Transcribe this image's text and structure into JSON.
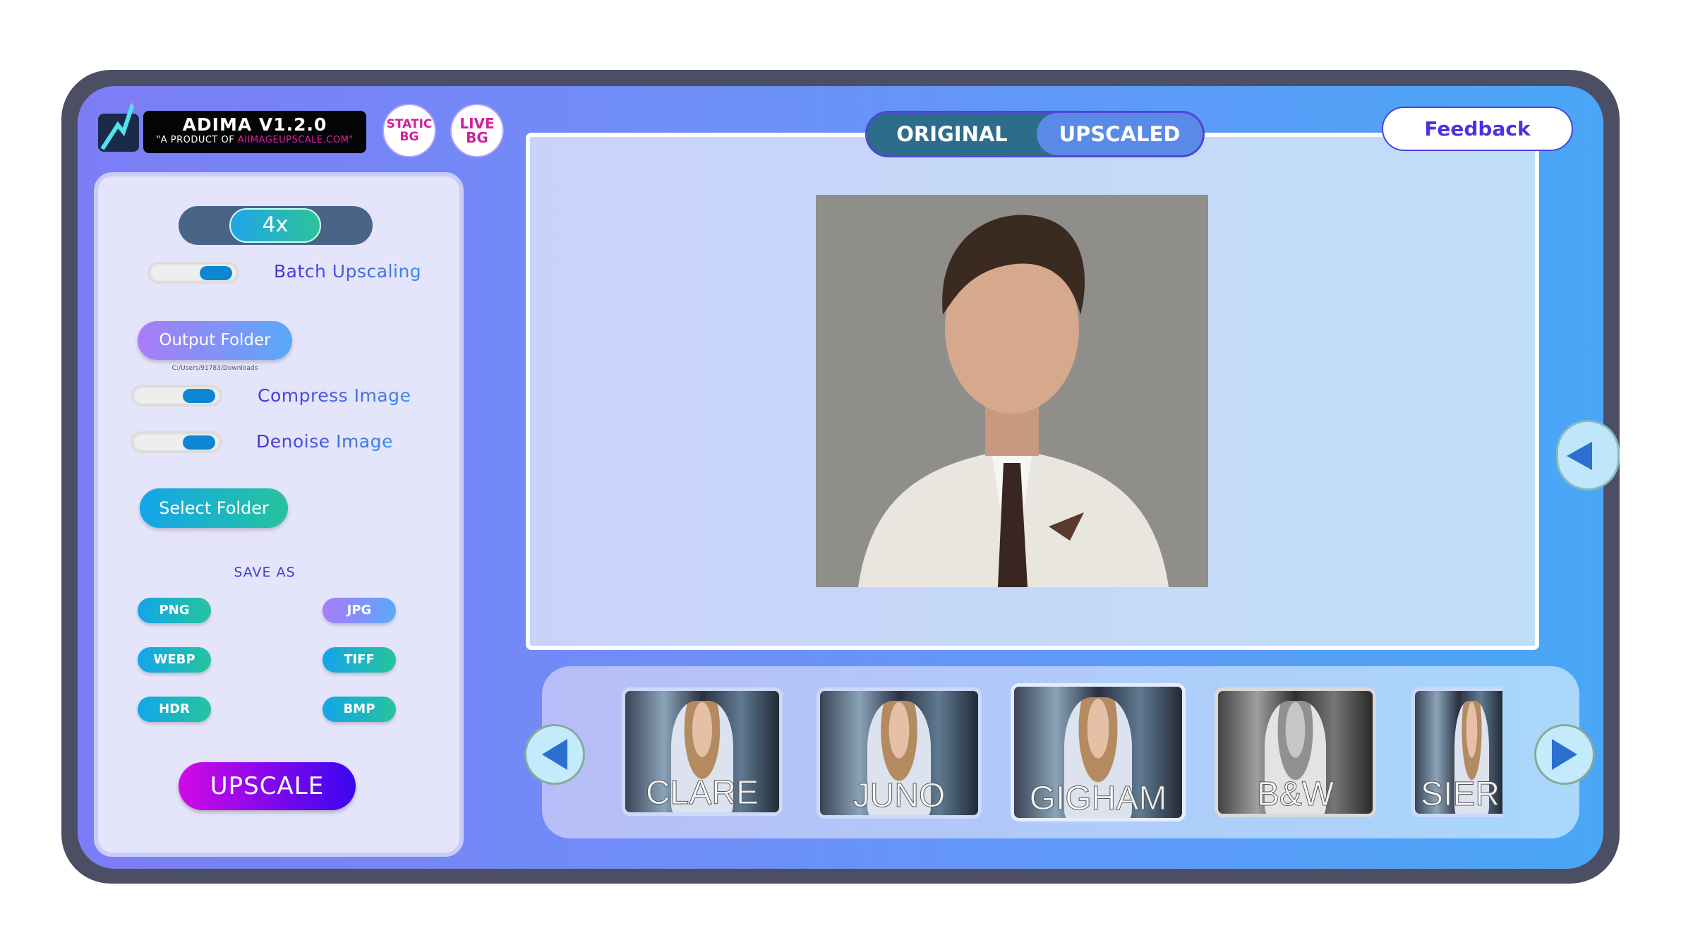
{
  "app": {
    "title": "ADIMA V1.2.0",
    "subtitle_prefix": "\"A PRODUCT OF ",
    "subtitle_brand": "AIIMAGEUPSCALE",
    "subtitle_suffix": ".COM\""
  },
  "header": {
    "static_bg": [
      "STATIC",
      "BG"
    ],
    "live_bg": [
      "LIVE",
      "BG"
    ],
    "feedback": "Feedback"
  },
  "view_toggle": {
    "original": "ORIGINAL",
    "upscaled": "UPSCALED",
    "selected": "UPSCALED"
  },
  "sidebar": {
    "scale": "4x",
    "batch_upscaling": {
      "label": "Batch Upscaling",
      "on": true
    },
    "output_folder": {
      "label": "Output Folder",
      "path": "C:/Users/91783/Downloads"
    },
    "compress_image": {
      "label": "Compress Image",
      "on": true
    },
    "denoise_image": {
      "label": "Denoise Image",
      "on": true
    },
    "select_folder": "Select Folder",
    "save_as": {
      "label": "SAVE AS",
      "formats": [
        "PNG",
        "JPG",
        "WEBP",
        "TIFF",
        "HDR",
        "BMP"
      ],
      "selected": "JPG"
    },
    "upscale": "UPSCALE"
  },
  "filters": {
    "items": [
      "CLARE",
      "JUNO",
      "GIGHAM",
      "B&W",
      "SIER"
    ],
    "selected": "GIGHAM"
  },
  "icons": {
    "prev": "triangle-left-icon",
    "next": "triangle-right-icon",
    "side": "triangle-left-icon"
  },
  "colors": {
    "accent_teal": "#14a5ea",
    "accent_purple": "#a97cf8",
    "upscale_gradient": [
      "#d10ae6",
      "#3a06f0"
    ],
    "label_text": "#4a3fd8"
  }
}
